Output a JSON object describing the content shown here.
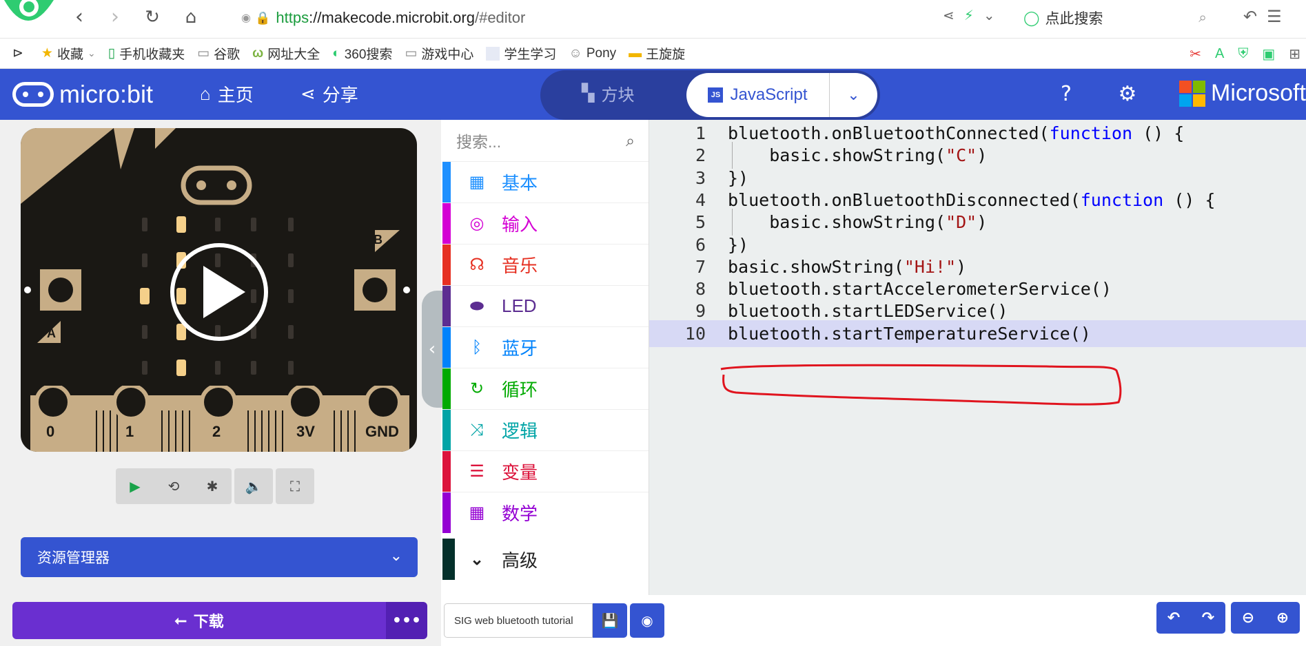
{
  "browser": {
    "url_proto": "https",
    "url_host": "://makecode.microbit.org",
    "url_path": "/#editor",
    "search_placeholder": "点此搜索"
  },
  "bookmarks": [
    {
      "label": "收藏",
      "icon": "star-icon"
    },
    {
      "label": "手机收藏夹",
      "icon": "phone-icon"
    },
    {
      "label": "谷歌",
      "icon": "page-icon"
    },
    {
      "label": "网址大全",
      "icon": "hao-icon"
    },
    {
      "label": "360搜索",
      "icon": "360-icon"
    },
    {
      "label": "游戏中心",
      "icon": "page-icon"
    },
    {
      "label": "学生学习",
      "icon": "square-icon"
    },
    {
      "label": "Pony",
      "icon": "avatar-icon"
    },
    {
      "label": "王旋旋",
      "icon": "folder-icon"
    }
  ],
  "header": {
    "brand": "micro:bit",
    "home": "主页",
    "share": "分享",
    "blocks": "方块",
    "javascript": "JavaScript",
    "js_badge": "JS",
    "microsoft": "Microsoft"
  },
  "simulator": {
    "pins": [
      "0",
      "1",
      "2",
      "3V",
      "GND"
    ],
    "button_a": "A",
    "button_b": "B"
  },
  "explorer": "资源管理器",
  "download": "下载",
  "toolbox": {
    "search_placeholder": "搜索...",
    "categories": [
      {
        "label": "基本",
        "color": "#1e90ff",
        "icon": "grid-icon"
      },
      {
        "label": "输入",
        "color": "#d400d4",
        "icon": "target-icon"
      },
      {
        "label": "音乐",
        "color": "#e63022",
        "icon": "headphones-icon"
      },
      {
        "label": "LED",
        "color": "#5c2d91",
        "icon": "toggle-icon"
      },
      {
        "label": "蓝牙",
        "color": "#0082fb",
        "icon": "bluetooth-icon"
      },
      {
        "label": "循环",
        "color": "#00aa00",
        "icon": "loop-icon"
      },
      {
        "label": "逻辑",
        "color": "#00a4a6",
        "icon": "shuffle-icon"
      },
      {
        "label": "变量",
        "color": "#dc143c",
        "icon": "lines-icon"
      },
      {
        "label": "数学",
        "color": "#9400d3",
        "icon": "calculator-icon"
      }
    ],
    "advanced": "高级"
  },
  "editor": {
    "lines": [
      {
        "n": "1",
        "parts": [
          [
            "bluetooth.onBluetoothConnected(",
            ""
          ],
          [
            "function",
            "kw"
          ],
          [
            " () {",
            ""
          ]
        ]
      },
      {
        "n": "2",
        "indent": true,
        "parts": [
          [
            "    basic.showString(",
            ""
          ],
          [
            "\"C\"",
            "str"
          ],
          [
            ")",
            ""
          ]
        ]
      },
      {
        "n": "3",
        "parts": [
          [
            "})",
            ""
          ]
        ]
      },
      {
        "n": "4",
        "parts": [
          [
            "bluetooth.onBluetoothDisconnected(",
            ""
          ],
          [
            "function",
            "kw"
          ],
          [
            " () {",
            ""
          ]
        ]
      },
      {
        "n": "5",
        "indent": true,
        "parts": [
          [
            "    basic.showString(",
            ""
          ],
          [
            "\"D\"",
            "str"
          ],
          [
            ")",
            ""
          ]
        ]
      },
      {
        "n": "6",
        "parts": [
          [
            "})",
            ""
          ]
        ]
      },
      {
        "n": "7",
        "parts": [
          [
            "basic.showString(",
            ""
          ],
          [
            "\"Hi!\"",
            "str"
          ],
          [
            ")",
            ""
          ]
        ]
      },
      {
        "n": "8",
        "parts": [
          [
            "bluetooth.startAccelerometerService()",
            ""
          ]
        ]
      },
      {
        "n": "9",
        "parts": [
          [
            "bluetooth.startLEDService()",
            ""
          ]
        ]
      },
      {
        "n": "10",
        "highlight": true,
        "parts": [
          [
            "bluetooth.startTemperatureService()",
            ""
          ]
        ]
      }
    ]
  },
  "project_name": "SIG web bluetooth tutorial",
  "colors": {
    "header_blue": "#3454d1",
    "download_purple": "#6a2fd0",
    "annotation_red": "#e0141e"
  }
}
